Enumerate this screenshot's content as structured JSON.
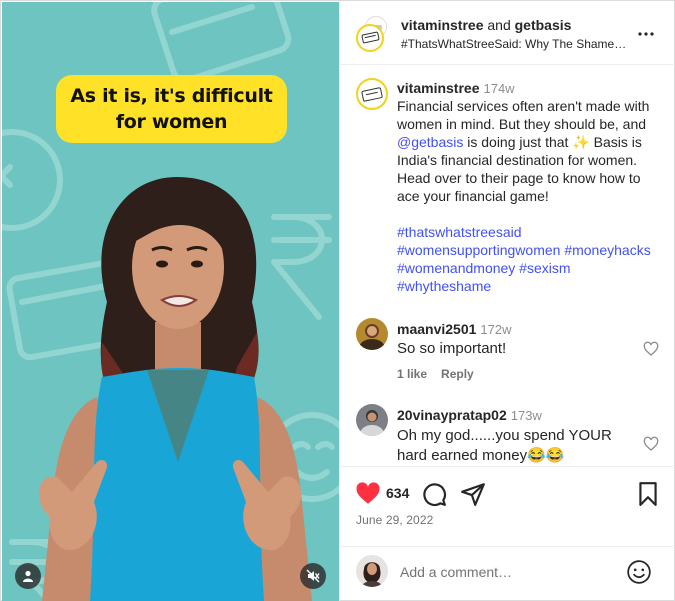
{
  "media": {
    "caption": "As it is, it's difficult for women",
    "colors": {
      "background": "#6ec4c0",
      "caption_bg": "#ffe227",
      "dress": "#19a6d6"
    }
  },
  "header": {
    "account1": "vitaminstree",
    "joiner": "and",
    "account2": "getbasis",
    "subtitle": "#ThatsWhatStreeSaid: Why The Shame…"
  },
  "caption": {
    "username": "vitaminstree",
    "time": "174w",
    "text_before_mention": "Financial services often aren't made with women in mind. But they should be, and",
    "mention": "@getbasis",
    "text_after_mention": "is doing just that ✨ Basis is India's financial destination for women. Head over to their page to know how to ace your financial game!",
    "hashtags": "#thatswhatstreesaid #womensupportingwomen #moneyhacks #womenandmoney #sexism #whytheshame"
  },
  "comments": [
    {
      "username": "maanvi2501",
      "time": "172w",
      "text": "So so important!",
      "likes": "1 like",
      "reply": "Reply"
    },
    {
      "username": "20vinaypratap02",
      "time": "173w",
      "text": "Oh my god......you spend YOUR hard earned money😂😂"
    }
  ],
  "actions": {
    "like_count": "634",
    "date": "June 29, 2022",
    "liked_color": "#ff3040"
  },
  "add_comment": {
    "placeholder": "Add a comment…"
  },
  "icons": [
    "more-icon",
    "heart-icon",
    "comment-icon",
    "share-icon",
    "bookmark-icon",
    "emoji-icon",
    "user-tag-icon",
    "muted-icon"
  ]
}
